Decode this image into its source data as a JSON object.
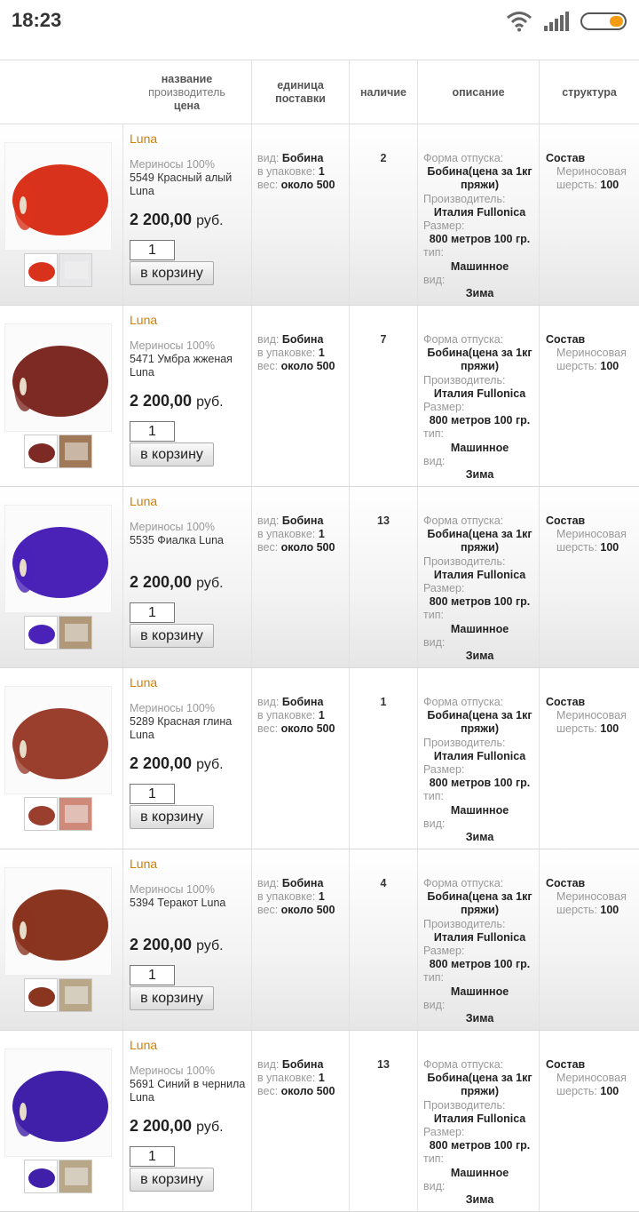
{
  "status": {
    "time": "18:23"
  },
  "headers": {
    "name_line1": "название",
    "name_line2": "производитель",
    "name_line3": "цена",
    "unit_line1": "единица",
    "unit_line2": "поставки",
    "stock": "наличие",
    "description": "описание",
    "structure": "структура"
  },
  "common": {
    "unit_kind_label": "вид:",
    "unit_kind_value": "Бобина",
    "pack_label": "в упаковке:",
    "pack_value": "1",
    "weight_label": "вес:",
    "weight_value": "около 500",
    "form_label": "Форма отпуска:",
    "form_value": "Бобина(цена за 1кг пряжи)",
    "maker_label": "Производитель:",
    "maker_value": "Италия Fullonica",
    "size_label": "Размер:",
    "size_value": "800 метров 100 гр.",
    "type_label": "тип:",
    "type_value": "Машинное",
    "kind_label": "вид:",
    "kind_value": "Зима",
    "struct_title": "Состав",
    "struct_material": "Мериносовая шерсть:",
    "struct_pct": "100",
    "currency": "руб.",
    "cart_label": "в корзину"
  },
  "products": [
    {
      "brand": "Luna",
      "composition": "Мериносы 100%",
      "name": "5549 Красный алый Luna",
      "price": "2 200,00",
      "qty": "1",
      "stock": "2",
      "color": "#d9321c",
      "thumb2": "#e8e8ea"
    },
    {
      "brand": "Luna",
      "composition": "Мериносы 100%",
      "name": "5471 Умбра жженая Luna",
      "price": "2 200,00",
      "qty": "1",
      "stock": "7",
      "color": "#7e2a24",
      "thumb2": "#a07a58"
    },
    {
      "brand": "Luna",
      "composition": "Мериносы 100%",
      "name": "5535 Фиалка Luna",
      "price": "2 200,00",
      "qty": "1",
      "stock": "13",
      "color": "#4a22b8",
      "thumb2": "#b09878"
    },
    {
      "brand": "Luna",
      "composition": "Мериносы 100%",
      "name": "5289 Красная глина Luna",
      "price": "2 200,00",
      "qty": "1",
      "stock": "1",
      "color": "#9a3e2e",
      "thumb2": "#d08a7a"
    },
    {
      "brand": "Luna",
      "composition": "Мериносы 100%",
      "name": "5394 Теракот Luna",
      "price": "2 200,00",
      "qty": "1",
      "stock": "4",
      "color": "#8a3520",
      "thumb2": "#b8a888"
    },
    {
      "brand": "Luna",
      "composition": "Мериносы 100%",
      "name": "5691 Синий в чернила Luna",
      "price": "2 200,00",
      "qty": "1",
      "stock": "13",
      "color": "#4020a8",
      "thumb2": "#b8a888"
    }
  ]
}
